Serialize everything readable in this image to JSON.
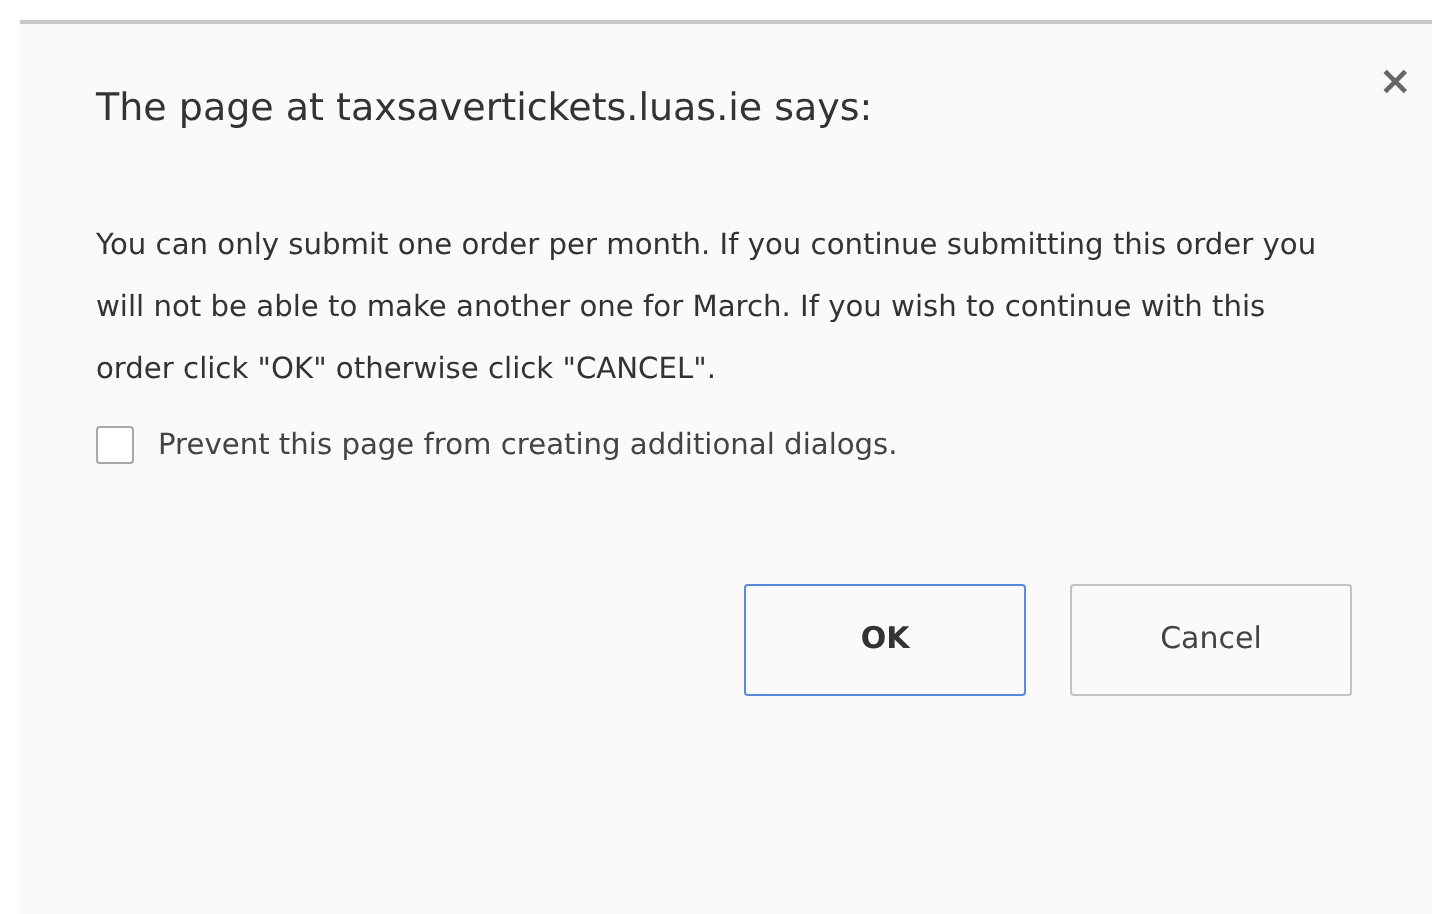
{
  "dialog": {
    "title": "The page at taxsavertickets.luas.ie says:",
    "close": "×",
    "message": "You can only submit one order per month. If you continue submitting this order you will not be able to make another one for March. If you wish to continue with this order click \"OK\" otherwise click \"CANCEL\".",
    "checkbox": {
      "label": "Prevent this page from creating additional dialogs.",
      "checked": false
    },
    "buttons": [
      {
        "label": "OK",
        "default": true
      },
      {
        "label": "Cancel",
        "default": false
      }
    ]
  }
}
